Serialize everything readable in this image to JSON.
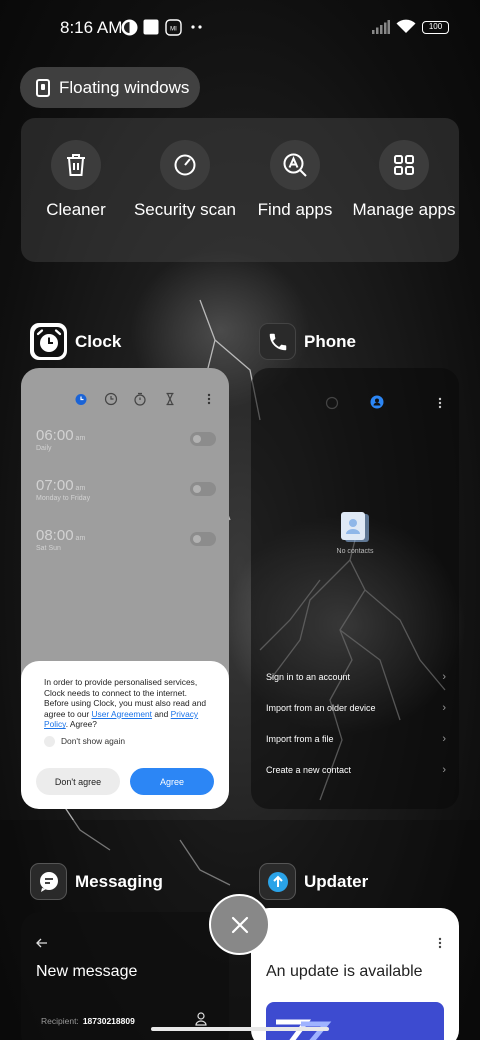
{
  "status_bar": {
    "time": "8:16 AM",
    "battery": "100"
  },
  "floating_windows": {
    "label": "Floating windows"
  },
  "quick_actions": [
    {
      "label": "Cleaner",
      "icon": "trash-icon"
    },
    {
      "label": "Security scan",
      "icon": "security-icon"
    },
    {
      "label": "Find apps",
      "icon": "find-apps-icon"
    },
    {
      "label": "Manage apps",
      "icon": "grid-icon"
    }
  ],
  "apps": {
    "clock": {
      "name": "Clock",
      "alarms": [
        {
          "time": "06:00",
          "ampm": "am",
          "repeat": "Daily"
        },
        {
          "time": "07:00",
          "ampm": "am",
          "repeat": "Monday to Friday"
        },
        {
          "time": "08:00",
          "ampm": "am",
          "repeat": "Sat Sun"
        }
      ],
      "consent": {
        "text_1": "In order to provide personalised services, Clock needs to connect to the internet. Before using Clock, you must also read and agree to our ",
        "user_agreement": "User Agreement",
        "and": " and ",
        "privacy_policy": "Privacy Policy",
        "text_2": ". Agree?",
        "dont_show": "Don't show again",
        "disagree": "Don't agree",
        "agree": "Agree"
      }
    },
    "phone": {
      "name": "Phone",
      "no_contacts": "No contacts",
      "options": [
        "Sign in to an account",
        "Import from an older device",
        "Import from a file",
        "Create a new contact"
      ]
    },
    "messaging": {
      "name": "Messaging",
      "title": "New message",
      "recipient_label": "Recipient:",
      "recipient_value": "18730218809"
    },
    "updater": {
      "name": "Updater",
      "title": "An update is available"
    }
  },
  "colors": {
    "accent_blue": "#2c86f5",
    "clock_bg": "#9e9e9e",
    "updater_banner": "#3d4bd0"
  }
}
